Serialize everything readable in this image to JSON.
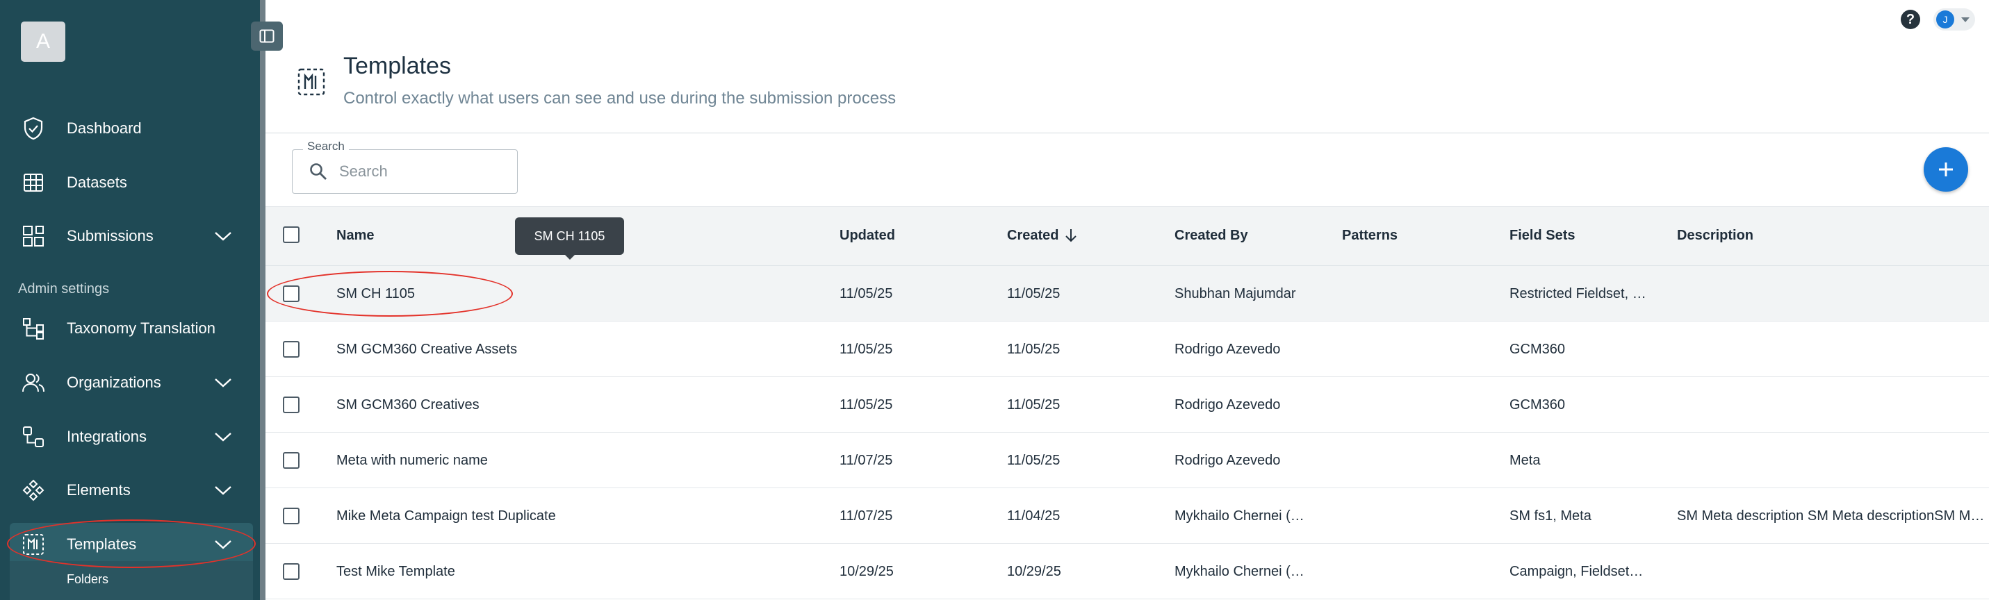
{
  "sidebar": {
    "avatar_letter": "A",
    "nav": [
      {
        "label": "Dashboard",
        "icon": "shield-check-icon",
        "has_chevron": false
      },
      {
        "label": "Datasets",
        "icon": "table-grid-icon",
        "has_chevron": false
      },
      {
        "label": "Submissions",
        "icon": "submissions-blocks-icon",
        "has_chevron": true
      }
    ],
    "section_label": "Admin settings",
    "admin_nav": [
      {
        "label": "Taxonomy Translation",
        "icon": "taxonomy-tree-icon",
        "has_chevron": false
      },
      {
        "label": "Organizations",
        "icon": "people-icon",
        "has_chevron": true
      },
      {
        "label": "Integrations",
        "icon": "integrations-icon",
        "has_chevron": true
      },
      {
        "label": "Elements",
        "icon": "elements-diamond-icon",
        "has_chevron": true
      },
      {
        "label": "Templates",
        "icon": "templates-icon",
        "has_chevron": true,
        "active": true
      }
    ],
    "sub_item": "Folders"
  },
  "topbar": {
    "help": "?",
    "user_initial": "J"
  },
  "header": {
    "title": "Templates",
    "subtitle": "Control exactly what users can see and use during the submission process"
  },
  "search": {
    "label": "Search",
    "placeholder": "Search",
    "value": ""
  },
  "table": {
    "columns": [
      "Name",
      "Updated",
      "Created",
      "Created By",
      "Patterns",
      "Field Sets",
      "Description"
    ],
    "sort_column": "Created",
    "sort_direction": "descending",
    "tooltip": "SM CH 1105",
    "rows": [
      {
        "name": "SM CH 1105",
        "updated": "11/05/25",
        "created": "11/05/25",
        "created_by": "Shubhan Majumdar",
        "patterns": "",
        "field_sets": "Restricted Fieldset, …",
        "description": ""
      },
      {
        "name": "SM GCM360 Creative Assets",
        "updated": "11/05/25",
        "created": "11/05/25",
        "created_by": "Rodrigo Azevedo",
        "patterns": "",
        "field_sets": "GCM360",
        "description": ""
      },
      {
        "name": "SM GCM360 Creatives",
        "updated": "11/05/25",
        "created": "11/05/25",
        "created_by": "Rodrigo Azevedo",
        "patterns": "",
        "field_sets": "GCM360",
        "description": ""
      },
      {
        "name": "Meta with numeric name",
        "updated": "11/07/25",
        "created": "11/05/25",
        "created_by": "Rodrigo Azevedo",
        "patterns": "",
        "field_sets": "Meta",
        "description": ""
      },
      {
        "name": "Mike Meta Campaign test Duplicate",
        "updated": "11/07/25",
        "created": "11/04/25",
        "created_by": "Mykhailo Chernei (…",
        "patterns": "",
        "field_sets": "SM fs1, Meta",
        "description": "SM Meta description SM Meta descriptionSM M…"
      },
      {
        "name": "Test Mike Template",
        "updated": "10/29/25",
        "created": "10/29/25",
        "created_by": "Mykhailo Chernei (…",
        "patterns": "",
        "field_sets": "Campaign, Fieldset…",
        "description": ""
      }
    ]
  },
  "colors": {
    "sidebar_bg": "#1f4a55",
    "accent": "#1a7ad8",
    "annotation": "#e3322a"
  }
}
